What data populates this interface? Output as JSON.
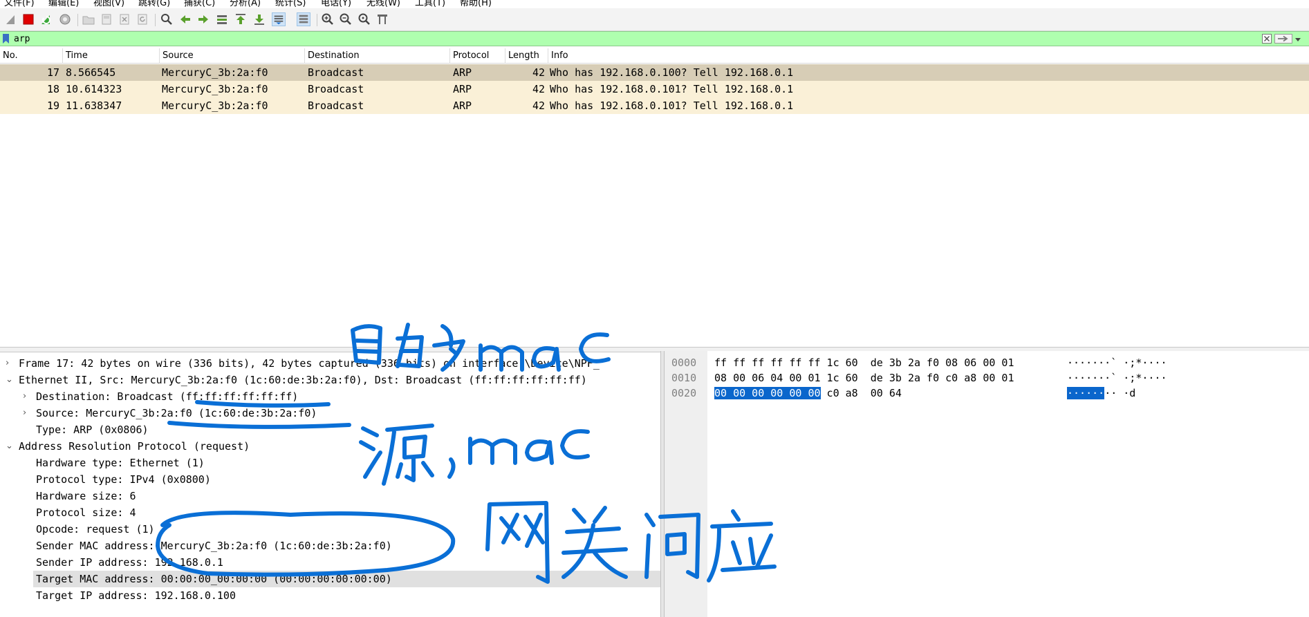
{
  "menu": [
    "文件(F)",
    "编辑(E)",
    "视图(V)",
    "跳转(G)",
    "捕获(C)",
    "分析(A)",
    "统计(S)",
    "电话(Y)",
    "无线(W)",
    "工具(T)",
    "帮助(H)"
  ],
  "toolbar_icons": [
    "shark-fin-start-icon",
    "stop-capture-icon",
    "restart-capture-icon",
    "capture-options-icon",
    "open-file-icon",
    "save-file-icon",
    "close-file-icon",
    "reload-file-icon",
    "find-packet-icon",
    "go-back-icon",
    "go-forward-icon",
    "go-to-packet-icon",
    "go-first-icon",
    "go-last-icon",
    "autoscroll-icon",
    "colorize-icon",
    "zoom-in-icon",
    "zoom-out-icon",
    "zoom-normal-icon",
    "resize-columns-icon"
  ],
  "filter": {
    "value": "arp"
  },
  "columns": [
    "No.",
    "Time",
    "Source",
    "Destination",
    "Protocol",
    "Length",
    "Info"
  ],
  "packets": [
    {
      "no": "17",
      "time": "8.566545",
      "source": "MercuryC_3b:2a:f0",
      "destination": "Broadcast",
      "protocol": "ARP",
      "length": "42",
      "info": "Who has 192.168.0.100? Tell 192.168.0.1"
    },
    {
      "no": "18",
      "time": "10.614323",
      "source": "MercuryC_3b:2a:f0",
      "destination": "Broadcast",
      "protocol": "ARP",
      "length": "42",
      "info": "Who has 192.168.0.101? Tell 192.168.0.1"
    },
    {
      "no": "19",
      "time": "11.638347",
      "source": "MercuryC_3b:2a:f0",
      "destination": "Broadcast",
      "protocol": "ARP",
      "length": "42",
      "info": "Who has 192.168.0.101? Tell 192.168.0.1"
    }
  ],
  "details": [
    {
      "arrow": "›",
      "text": "Frame 17: 42 bytes on wire (336 bits), 42 bytes captured (336 bits) on interface \\Device\\NPF_"
    },
    {
      "arrow": "⌄",
      "text": "Ethernet II, Src: MercuryC_3b:2a:f0 (1c:60:de:3b:2a:f0), Dst: Broadcast (ff:ff:ff:ff:ff:ff)"
    },
    {
      "arrow": "›",
      "text": "Destination: Broadcast (ff:ff:ff:ff:ff:ff)"
    },
    {
      "arrow": "›",
      "text": "Source: MercuryC_3b:2a:f0 (1c:60:de:3b:2a:f0)"
    },
    {
      "arrow": "",
      "text": "Type: ARP (0x0806)"
    },
    {
      "arrow": "⌄",
      "text": "Address Resolution Protocol (request)"
    },
    {
      "arrow": "",
      "text": "Hardware type: Ethernet (1)"
    },
    {
      "arrow": "",
      "text": "Protocol type: IPv4 (0x0800)"
    },
    {
      "arrow": "",
      "text": "Hardware size: 6"
    },
    {
      "arrow": "",
      "text": "Protocol size: 4"
    },
    {
      "arrow": "",
      "text": "Opcode: request (1)"
    },
    {
      "arrow": "",
      "text": "Sender MAC address: MercuryC_3b:2a:f0 (1c:60:de:3b:2a:f0)"
    },
    {
      "arrow": "",
      "text": "Sender IP address: 192.168.0.1"
    },
    {
      "arrow": "",
      "text": "Target MAC address: 00:00:00_00:00:00 (00:00:00:00:00:00)"
    },
    {
      "arrow": "",
      "text": "Target IP address: 192.168.0.100"
    }
  ],
  "bytes": {
    "offsets": [
      "0000",
      "0010",
      "0020"
    ],
    "row0_hex": "ff ff ff ff ff ff 1c 60  de 3b 2a f0 08 06 00 01",
    "row1_hex": "08 00 06 04 00 01 1c 60  de 3b 2a f0 c0 a8 00 01",
    "row2_hex_selected": "00 00 00 00 00 00",
    "row2_hex_rest": " c0 a8  00 64",
    "row0_ascii": "·······` ·;*····",
    "row1_ascii": "·······` ·;*····",
    "row2_ascii_selected": "······",
    "row2_ascii_rest": "·· ·d"
  },
  "annotations": {
    "ink_color": "#0a6fd6",
    "dest_mac_note": "目的mac",
    "src_mac_note": "源,mac",
    "gateway_note": "网关问应"
  }
}
